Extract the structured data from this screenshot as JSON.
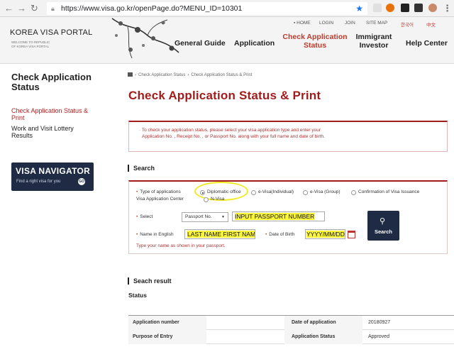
{
  "browser": {
    "url": "https://www.visa.go.kr/openPage.do?MENU_ID=10301"
  },
  "header": {
    "logo": "KOREA VISA PORTAL",
    "logo_sub": "WELCOME TO REPUBLIC OF KOREA VISA PORTAL",
    "utils": {
      "home": "HOME",
      "login": "LOGIN",
      "join": "JOIN",
      "sitemap": "SITE MAP",
      "korean": "한국어",
      "chinese": "中文"
    },
    "nav": {
      "general_guide": "General Guide",
      "application": "Application",
      "check_status": "Check Application Status",
      "immigrant_investor": "Immigrant Investor",
      "help_center": "Help Center"
    }
  },
  "sidebar": {
    "title": "Check Application Status",
    "items": [
      "Check Application Status & Print",
      "Work and Visit Lottery Results"
    ],
    "banner_title": "VISA NAVIGATOR",
    "banner_sub": "Find a right visa for you",
    "banner_go": "GO"
  },
  "breadcrumb": {
    "first": "Check Application Status",
    "second": "Check Application Status & Print"
  },
  "page_title": "Check Application Status & Print",
  "info": {
    "line1": "· To check your application status, please select your visa application type and enter your",
    "line2": "Application No. , Receipt No. , or Passport No. along with your full name and date of birth."
  },
  "search_section": {
    "heading": "Search",
    "type_label": "Type of applications",
    "options": {
      "diplomatic": "Diplomatic office",
      "evisa_individual": "e-Visa(Individual)",
      "evisa_group": "e-Visa (Group)",
      "confirmation": "Confirmation of Visa Issuance",
      "visa_center": "Visa Application Center",
      "nvisa": "N-Visa"
    },
    "select_label": "Select",
    "select_value": "Passport No.",
    "passport_input": "INPUT PASSPORT NUMBER",
    "name_label": "Name in English",
    "name_input": "LAST NAME FIRST NAME",
    "dob_label": "Date of Birth",
    "dob_input": "YYYY/MM/DD",
    "hint": "Type your name as shown in your passport.",
    "search_button": "Search"
  },
  "result_section": {
    "heading": "Seach result",
    "status_label": "Status",
    "rows": [
      {
        "label1": "Application number",
        "value1": "",
        "label2": "Date of application",
        "value2": "20180927"
      },
      {
        "label1": "Purpose of Entry",
        "value1": "",
        "label2": "Application Status",
        "value2": "Approved"
      }
    ]
  }
}
